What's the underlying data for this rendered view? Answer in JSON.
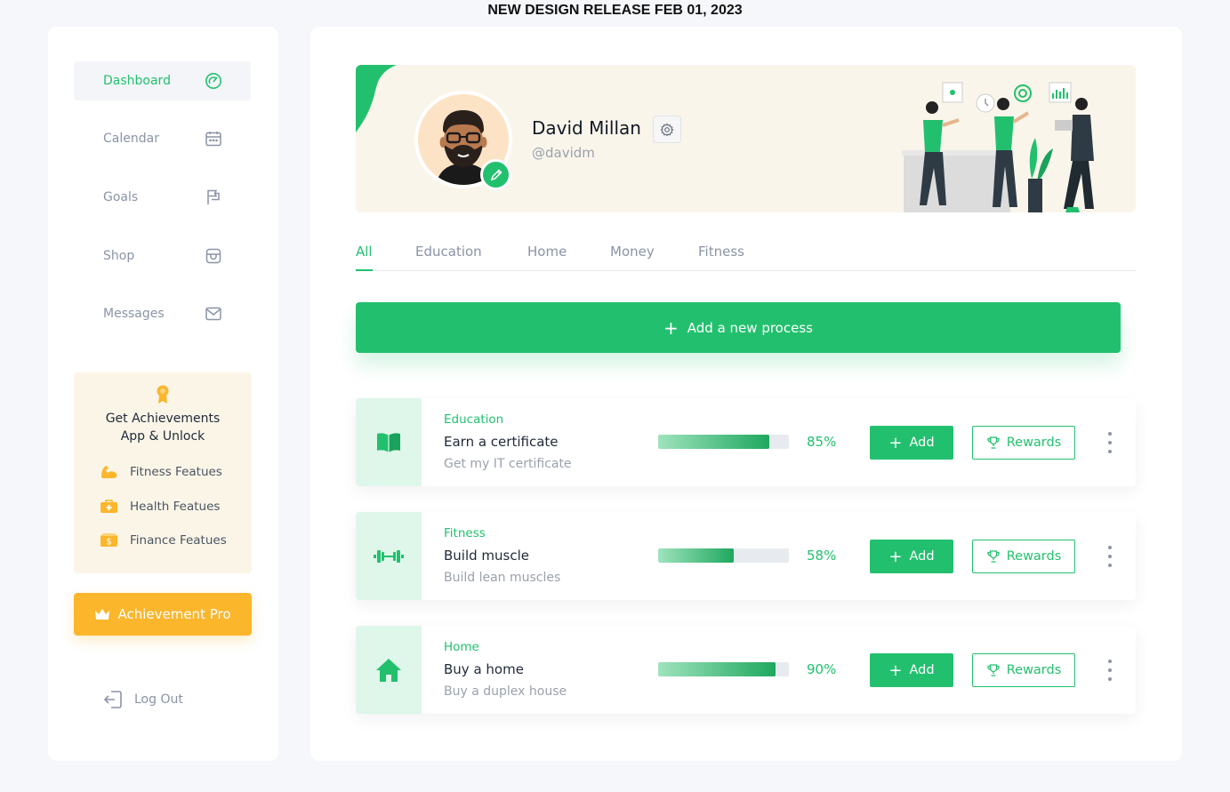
{
  "banner_text": "NEW DESIGN RELEASE FEB 01, 2023",
  "colors": {
    "accent": "#22c06e",
    "pro": "#fbb62c",
    "card_bg": "#fbf5e8"
  },
  "sidebar": {
    "items": [
      {
        "label": "Dashboard",
        "icon": "gauge-icon",
        "active": true
      },
      {
        "label": "Calendar",
        "icon": "calendar-icon",
        "active": false
      },
      {
        "label": "Goals",
        "icon": "flag-icon",
        "active": false
      },
      {
        "label": "Shop",
        "icon": "shop-icon",
        "active": false
      },
      {
        "label": "Messages",
        "icon": "mail-icon",
        "active": false
      }
    ],
    "achievements": {
      "title_line1": "Get Achievements",
      "title_line2": "App & Unlock",
      "features": [
        {
          "label": "Fitness Featues",
          "icon": "muscle-icon"
        },
        {
          "label": "Health Featues",
          "icon": "medical-kit-icon"
        },
        {
          "label": "Finance Featues",
          "icon": "money-icon"
        }
      ]
    },
    "pro_button": "Achievement Pro",
    "logout": "Log Out"
  },
  "profile": {
    "name": "David Millan",
    "handle": "@davidm"
  },
  "tabs": [
    "All",
    "Education",
    "Home",
    "Money",
    "Fitness"
  ],
  "active_tab": "All",
  "add_process_label": "Add a new process",
  "processes": [
    {
      "category": "Education",
      "title": "Earn a certificate",
      "subtitle": "Get my IT certificate",
      "progress": 85,
      "progress_label": "85%",
      "icon": "book-icon"
    },
    {
      "category": "Fitness",
      "title": "Build muscle",
      "subtitle": "Build lean muscles",
      "progress": 58,
      "progress_label": "58%",
      "icon": "dumbbell-icon"
    },
    {
      "category": "Home",
      "title": "Buy a home",
      "subtitle": "Buy a duplex house",
      "progress": 90,
      "progress_label": "90%",
      "icon": "house-icon"
    }
  ],
  "row_actions": {
    "add": "Add",
    "rewards": "Rewards"
  }
}
